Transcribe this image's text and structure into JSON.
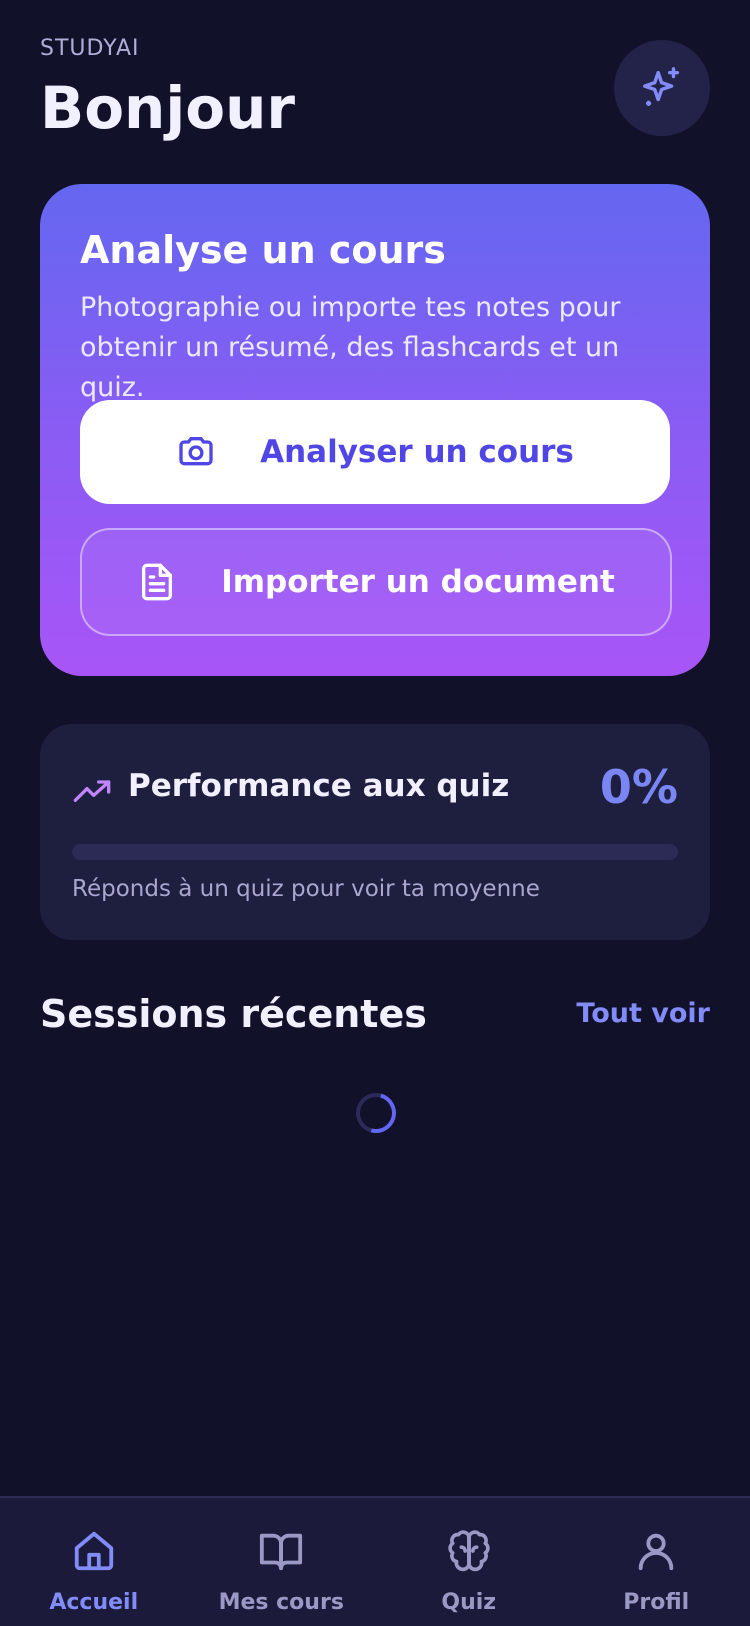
{
  "header": {
    "app_name": "STUDYAI",
    "greeting": "Bonjour",
    "sparkle_icon": "sparkles-icon"
  },
  "hero": {
    "title": "Analyse un cours",
    "description": "Photographie ou importe tes notes pour obtenir un résumé, des flashcards et un quiz.",
    "primary_button": {
      "label": "Analyser un cours",
      "icon": "camera-icon"
    },
    "secondary_button": {
      "label": "Importer un document",
      "icon": "file-text-icon"
    }
  },
  "performance": {
    "title": "Performance aux quiz",
    "value": "0%",
    "progress": 0,
    "hint": "Réponds à un quiz pour voir ta moyenne",
    "icon": "trending-up-icon"
  },
  "sessions": {
    "title": "Sessions récentes",
    "see_all": "Tout voir"
  },
  "tabbar": {
    "items": [
      {
        "label": "Accueil",
        "icon": "home-icon",
        "active": true
      },
      {
        "label": "Mes cours",
        "icon": "book-open-icon",
        "active": false
      },
      {
        "label": "Quiz",
        "icon": "brain-icon",
        "active": false
      },
      {
        "label": "Profil",
        "icon": "user-icon",
        "active": false
      }
    ]
  },
  "colors": {
    "background": "#12112a",
    "accent": "#818cf8",
    "card": "#1e1e3f",
    "gradient_start": "#6467f1",
    "gradient_end": "#a855f7"
  }
}
